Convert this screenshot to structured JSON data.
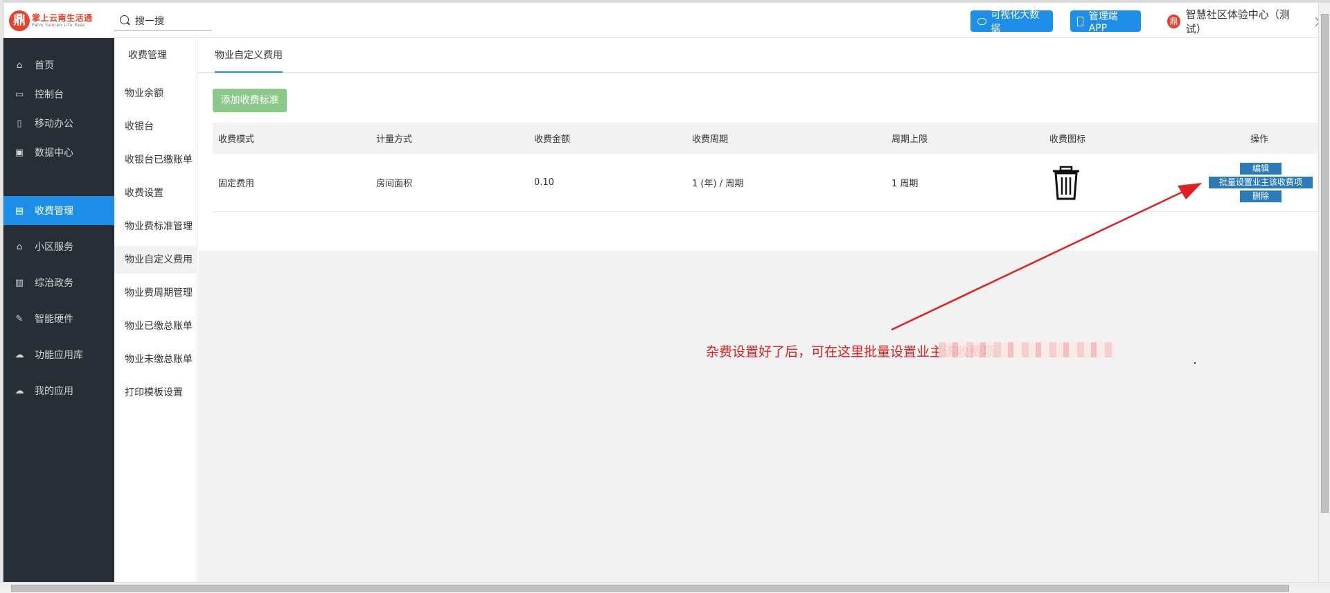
{
  "header": {
    "logo_badge": "鼎",
    "logo_cn": "掌上云南生活通",
    "logo_en": "Palm Yunnan Life Pass",
    "search_text": "搜一搜",
    "bigdata_label": "可视化大数据",
    "app_label": "管理端APP",
    "community_badge": "鼎",
    "community_label": "智慧社区体验中心（测试）"
  },
  "sidebar": {
    "items": [
      {
        "label": "首页",
        "icon": "home-icon"
      },
      {
        "label": "控制台",
        "icon": "laptop-icon"
      },
      {
        "label": "移动办公",
        "icon": "mobile-icon"
      },
      {
        "label": "数据中心",
        "icon": "briefcase-icon"
      },
      {
        "label": "收费管理",
        "icon": "card-icon"
      },
      {
        "label": "小区服务",
        "icon": "home-icon"
      },
      {
        "label": "综治政务",
        "icon": "bank-icon"
      },
      {
        "label": "智能硬件",
        "icon": "wrench-icon"
      },
      {
        "label": "功能应用库",
        "icon": "cloud-download-icon"
      },
      {
        "label": "我的应用",
        "icon": "cloud-icon"
      }
    ]
  },
  "subnav": {
    "title": "收费管理",
    "items": [
      "物业余额",
      "收银台",
      "收银台已缴账单",
      "收费设置",
      "物业费标准管理",
      "物业自定义费用",
      "物业费周期管理",
      "物业已缴总账单",
      "物业未缴总账单",
      "打印模板设置"
    ]
  },
  "main": {
    "tab_label": "物业自定义费用",
    "add_button": "添加收费标准",
    "table": {
      "headers": [
        "收费模式",
        "计量方式",
        "收费金额",
        "收费周期",
        "周期上限",
        "收费图标",
        "操作"
      ],
      "rows": [
        {
          "mode": "固定费用",
          "method": "房间面积",
          "amount": "0.10",
          "cycle": "1 (年) / 周期",
          "limit": "1 周期",
          "icon": "trash-icon",
          "ops": [
            "编辑",
            "批量设置业主该收费项",
            "删除"
          ]
        }
      ]
    },
    "annotation": "杂费设置好了后，可在这里批量设置业主该收费项"
  },
  "colors": {
    "brand_red": "#e8412c",
    "accent_blue": "#1e8fe8",
    "sidebar_dark": "#272e36",
    "add_green": "#8bc98b",
    "op_blue": "#2b7bb9",
    "annotation_red": "#e02020"
  }
}
